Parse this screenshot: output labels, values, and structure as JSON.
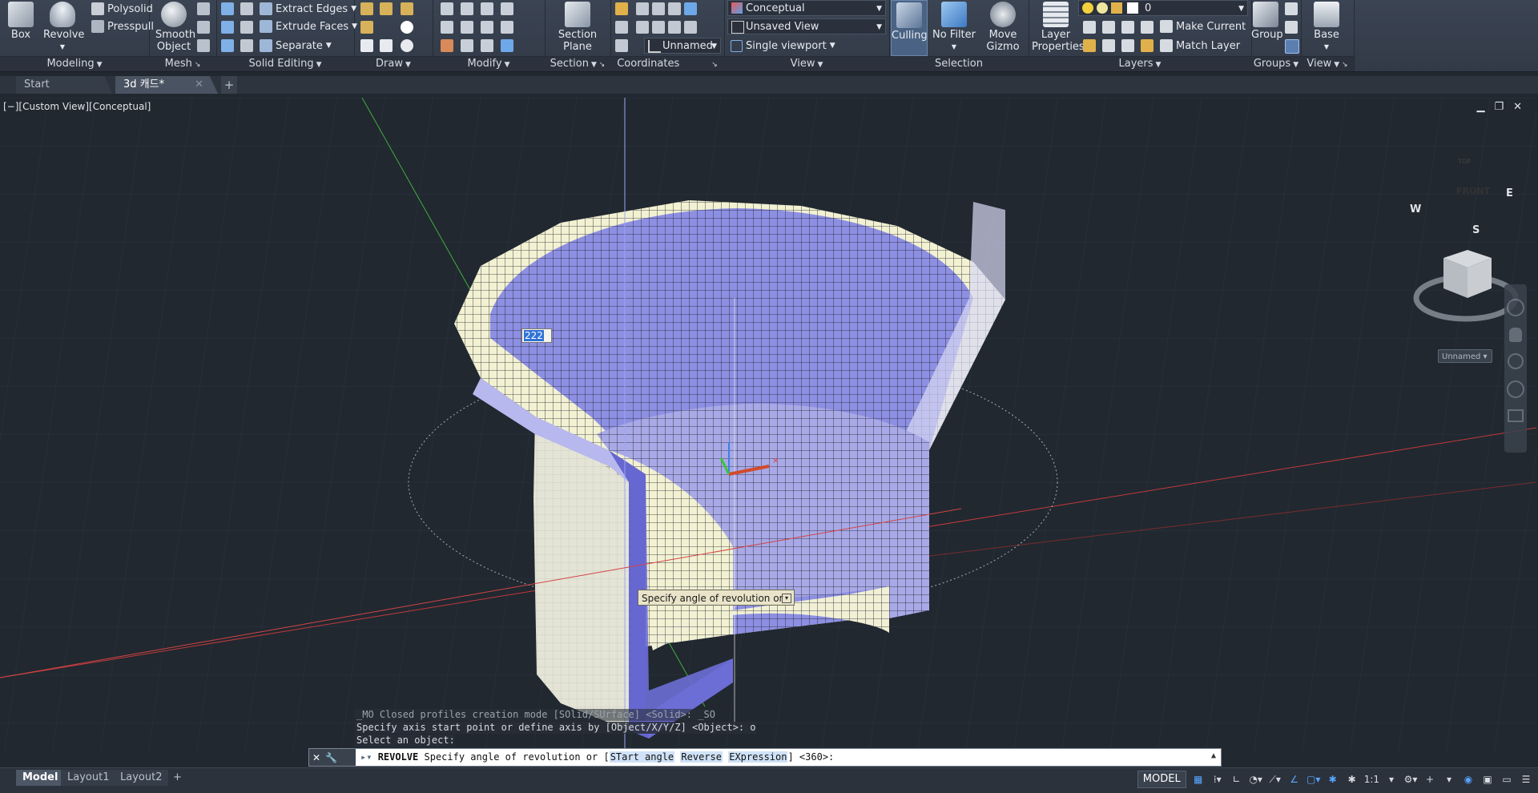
{
  "ribbon": {
    "modeling": {
      "title": "Modeling",
      "box": "Box",
      "revolve": "Revolve",
      "polysolid": "Polysolid",
      "presspull": "Presspull"
    },
    "mesh": {
      "title": "Mesh",
      "smooth_object": "Smooth Object"
    },
    "solid_editing": {
      "title": "Solid Editing",
      "extract_edges": "Extract Edges",
      "extrude_faces": "Extrude Faces",
      "separate": "Separate"
    },
    "draw": {
      "title": "Draw"
    },
    "modify": {
      "title": "Modify"
    },
    "section": {
      "title": "Section",
      "section_plane": "Section Plane"
    },
    "coordinates": {
      "title": "Coordinates",
      "ucs_name": "Unnamed"
    },
    "view": {
      "title": "View",
      "visual_style": "Conceptual",
      "named_view": "Unsaved View",
      "viewport_config": "Single viewport"
    },
    "selection": {
      "title": "Selection",
      "culling": "Culling",
      "no_filter": "No Filter",
      "move_gizmo": "Move Gizmo"
    },
    "layers": {
      "title": "Layers",
      "layer_properties": "Layer Properties",
      "current_layer": "0",
      "make_current": "Make Current",
      "match_layer": "Match Layer"
    },
    "groups": {
      "title": "Groups",
      "group": "Group"
    },
    "view2": {
      "title": "View",
      "base": "Base"
    }
  },
  "tabs": {
    "start": "Start",
    "drawing": "3d 캐드*"
  },
  "viewport": {
    "label": "[−][Custom View][Conceptual]",
    "angle_input": "222",
    "tooltip": "Specify angle of revolution or",
    "viewcube": {
      "top": "TOP",
      "front": "FRONT",
      "compass_w": "W",
      "compass_e": "E",
      "compass_s": "S"
    },
    "ucs_dropdown": "Unnamed"
  },
  "command": {
    "history": [
      "_MO Closed profiles creation mode [SOlid/SUrface] <Solid>: _SO",
      "Specify axis start point or define axis by [Object/X/Y/Z] <Object>: o",
      "Select an object:"
    ],
    "command_name": "REVOLVE",
    "prompt": "Specify angle of revolution or [",
    "option_1": "STart angle",
    "option_2": "Reverse",
    "option_3": "EXpression",
    "prompt_end": "] <360>:"
  },
  "layouts": {
    "model": "Model",
    "layout1": "Layout1",
    "layout2": "Layout2"
  },
  "status": {
    "model": "MODEL",
    "scale": "1:1"
  },
  "colors": {
    "viewport_bg": "#212830",
    "solid_face_light": "#f4f3d7",
    "solid_face_blue": "#8b8de0",
    "solid_face_dark": "#6c6dd2",
    "x_axis": "#d23b3b",
    "y_axis": "#3bbf3b"
  }
}
